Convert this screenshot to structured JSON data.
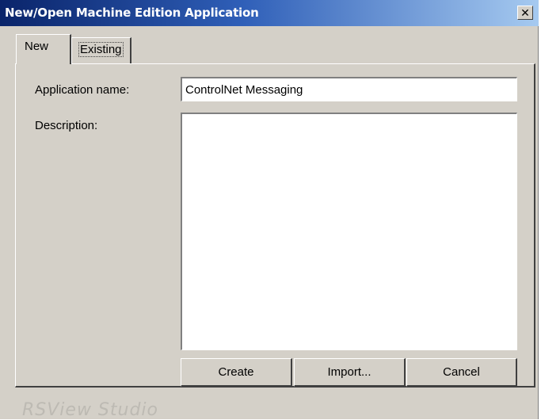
{
  "window": {
    "title": "New/Open Machine Edition Application",
    "close_symbol": "✕",
    "close_icon": "close-icon"
  },
  "tabs": [
    {
      "label": "New",
      "selected": true
    },
    {
      "label": "Existing",
      "selected": false
    }
  ],
  "form": {
    "app_name_label": "Application name:",
    "app_name_value": "ControlNet Messaging",
    "description_label": "Description:",
    "description_value": ""
  },
  "buttons": {
    "create": "Create",
    "import": "Import...",
    "cancel": "Cancel"
  },
  "status_bar": {
    "text": "RSView Studio"
  },
  "colors": {
    "dialog_face": "#d4d0c8",
    "title_gradient_start": "#0a246a",
    "title_gradient_end": "#a6caf0",
    "title_text": "#ffffff"
  }
}
